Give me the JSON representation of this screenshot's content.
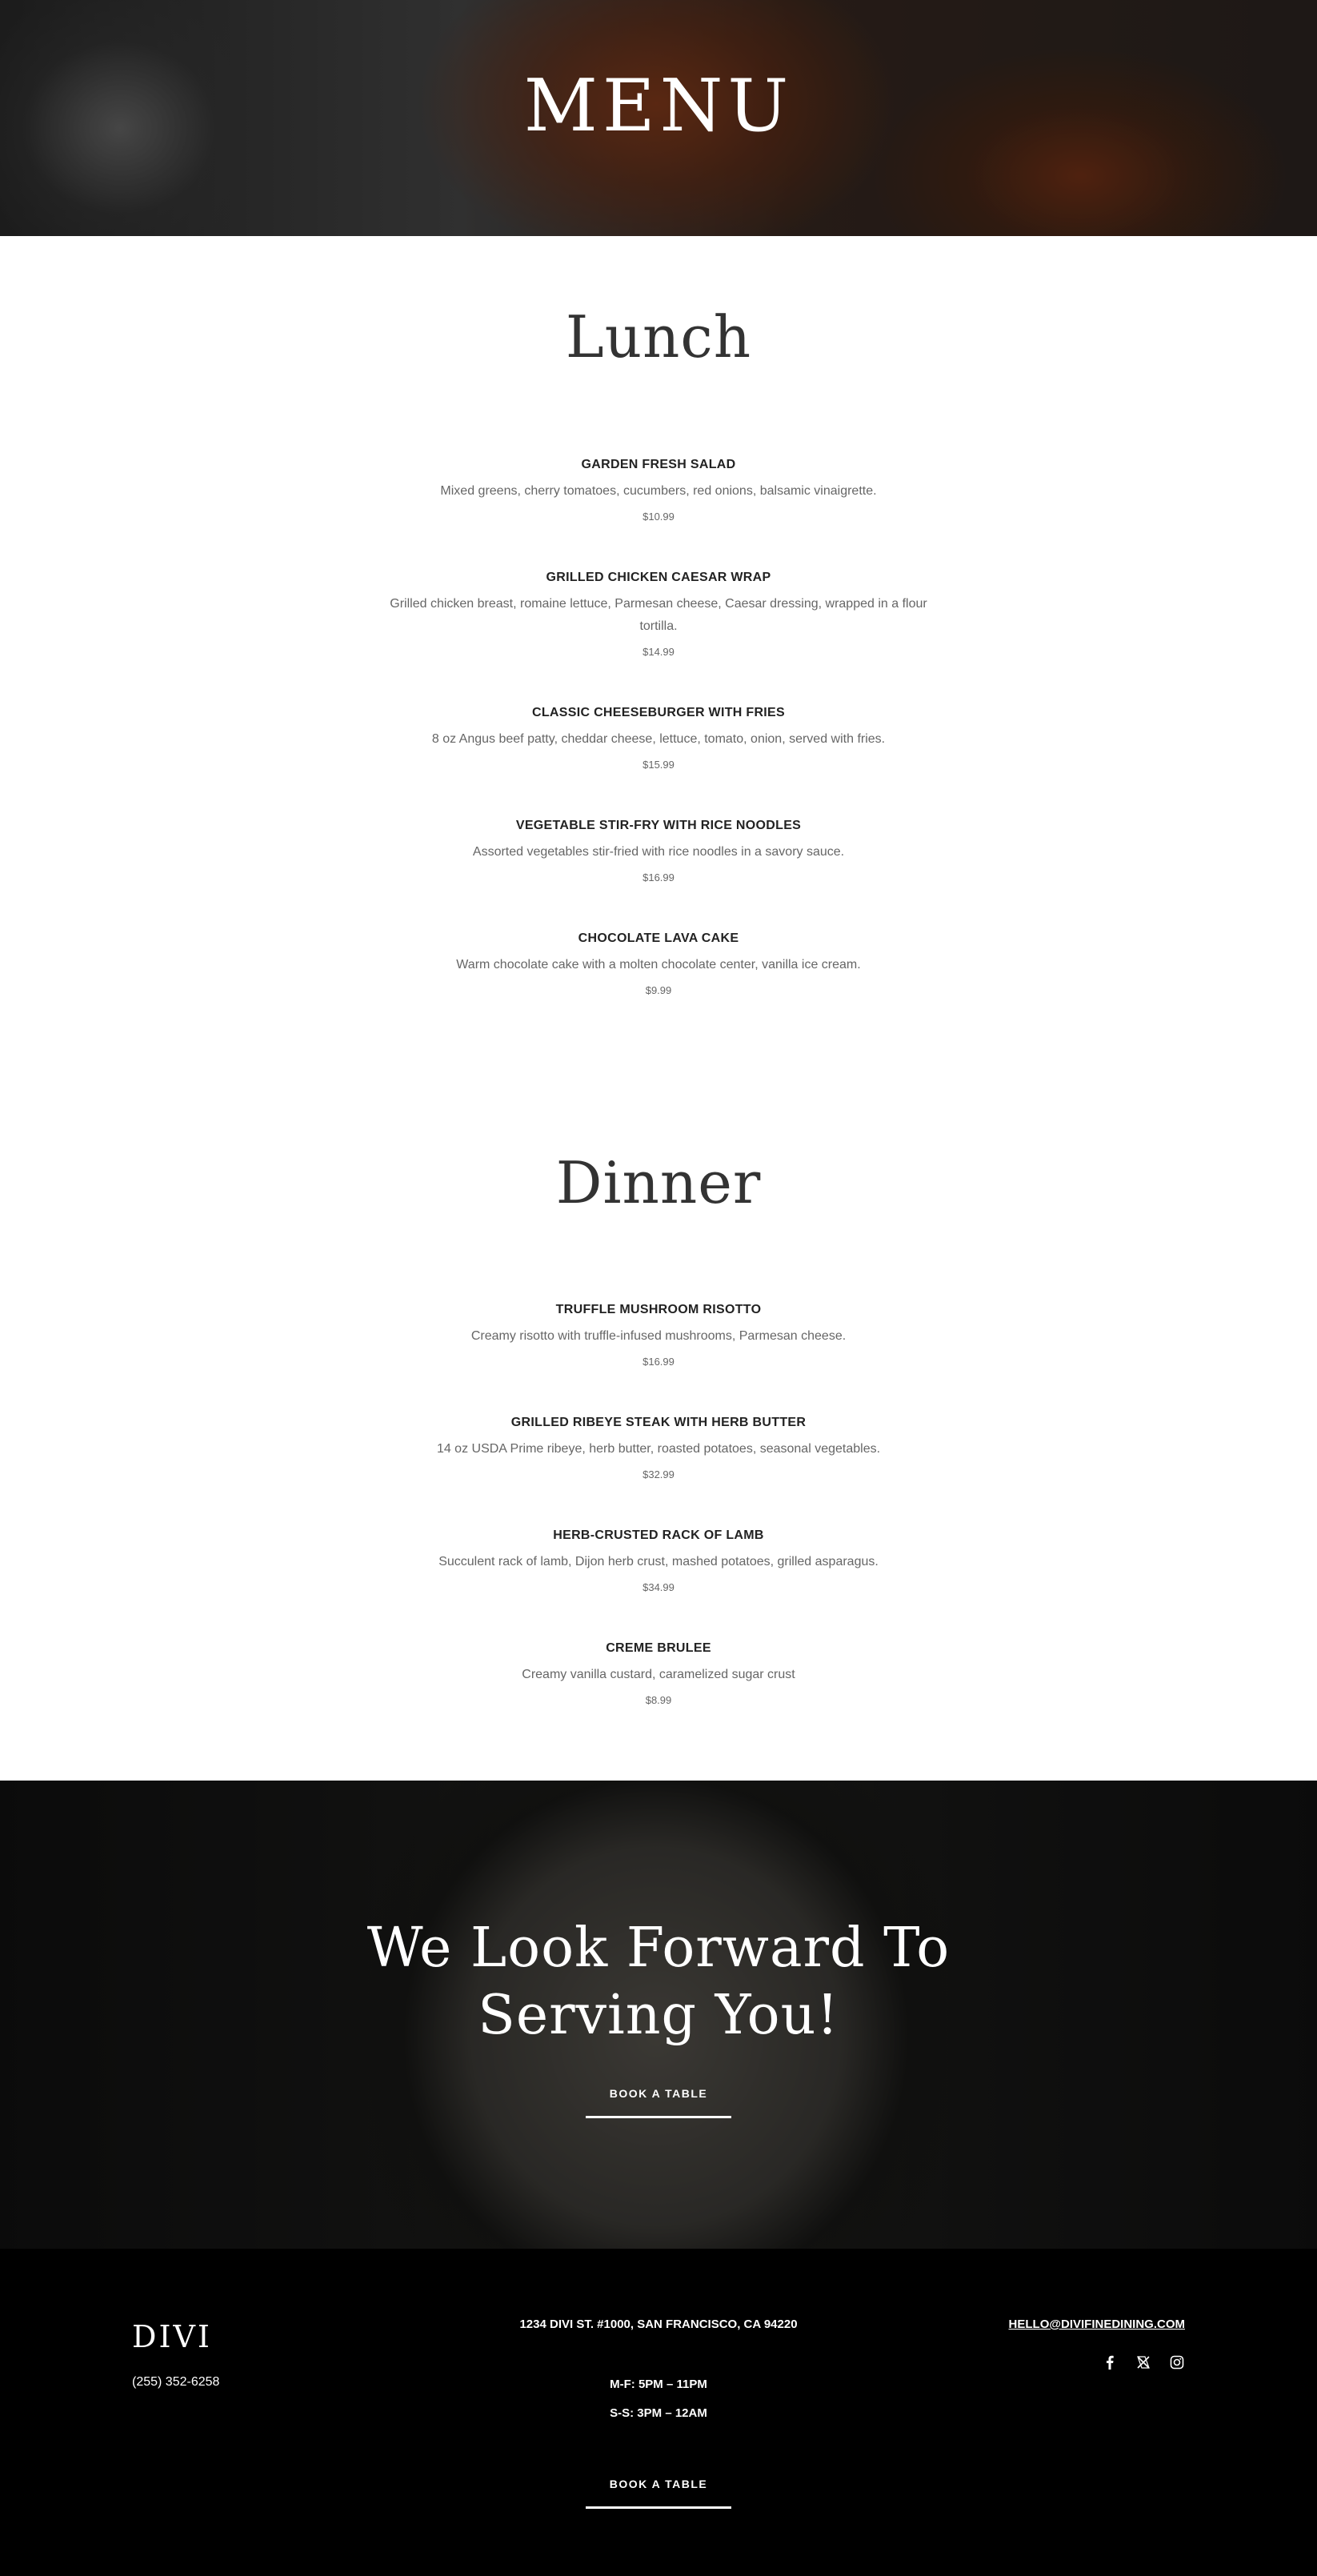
{
  "hero": {
    "title": "MENU"
  },
  "lunch": {
    "heading": "Lunch",
    "items": [
      {
        "name": "GARDEN FRESH SALAD",
        "description": "Mixed greens, cherry tomatoes, cucumbers, red onions, balsamic vinaigrette.",
        "price": "$10.99"
      },
      {
        "name": "GRILLED CHICKEN CAESAR WRAP",
        "description": "Grilled chicken breast, romaine lettuce, Parmesan cheese, Caesar dressing, wrapped in a flour tortilla.",
        "price": "$14.99"
      },
      {
        "name": "CLASSIC CHEESEBURGER WITH FRIES",
        "description": "8 oz Angus beef patty, cheddar cheese, lettuce, tomato, onion, served with fries.",
        "price": "$15.99"
      },
      {
        "name": "VEGETABLE STIR-FRY WITH RICE NOODLES",
        "description": "Assorted vegetables stir-fried with rice noodles in a savory sauce.",
        "price": "$16.99"
      },
      {
        "name": "CHOCOLATE LAVA CAKE",
        "description": "Warm chocolate cake with a molten chocolate center, vanilla ice cream.",
        "price": "$9.99"
      }
    ]
  },
  "dinner": {
    "heading": "Dinner",
    "items": [
      {
        "name": "TRUFFLE MUSHROOM RISOTTO",
        "description": "Creamy risotto with truffle-infused mushrooms, Parmesan cheese.",
        "price": "$16.99"
      },
      {
        "name": "GRILLED RIBEYE STEAK WITH HERB BUTTER",
        "description": "14 oz USDA Prime ribeye, herb butter, roasted potatoes, seasonal vegetables.",
        "price": "$32.99"
      },
      {
        "name": "HERB-CRUSTED RACK OF LAMB",
        "description": "Succulent rack of lamb, Dijon herb crust, mashed potatoes, grilled asparagus.",
        "price": "$34.99"
      },
      {
        "name": "CREME BRULEE",
        "description": "Creamy vanilla custard, caramelized sugar crust",
        "price": "$8.99"
      }
    ]
  },
  "cta": {
    "line1": "We Look Forward To",
    "line2": "Serving You!",
    "button": "BOOK A TABLE"
  },
  "footer": {
    "logo": "DIVI",
    "phone": "(255) 352-6258",
    "address": "1234 DIVI ST. #1000, SAN FRANCISCO, CA 94220",
    "hours_weekday": "M-F: 5PM – 11PM",
    "hours_weekend": "S-S: 3PM – 12AM",
    "email": "HELLO@DIVIFINEDINING.COM",
    "social_icons": [
      "facebook-icon",
      "x-icon",
      "instagram-icon"
    ],
    "button": "BOOK A TABLE"
  }
}
